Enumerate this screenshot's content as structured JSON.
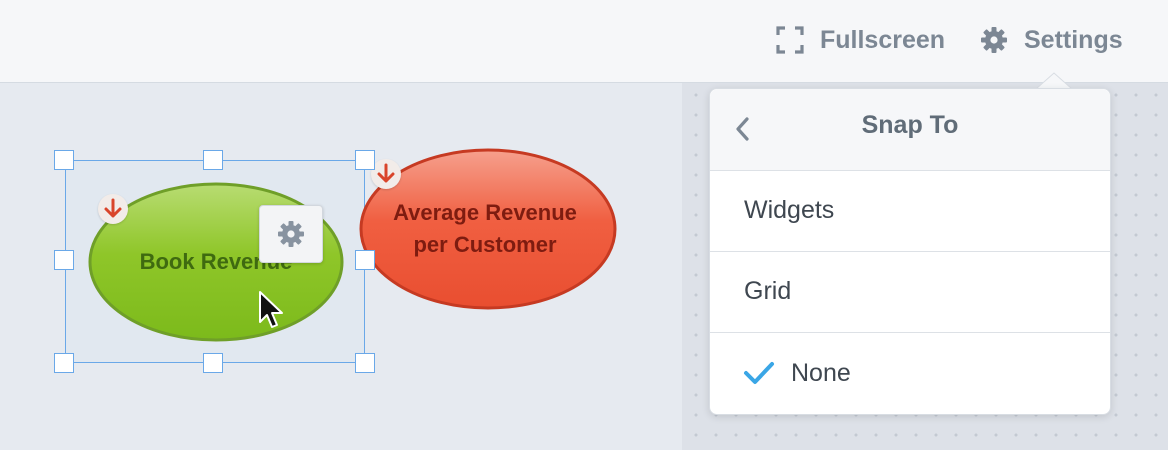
{
  "toolbar": {
    "fullscreen_label": "Fullscreen",
    "settings_label": "Settings",
    "fullscreen_icon": "fullscreen-icon",
    "settings_icon": "gear-icon"
  },
  "widgets": {
    "book_revenue": {
      "label": "Book Revenue",
      "color": "#86c11f",
      "arrow": "arrow-down-icon"
    },
    "avg_revenue": {
      "line1": "Average Revenue",
      "line2": "per Customer",
      "color": "#ef5a3c",
      "arrow": "arrow-down-icon"
    }
  },
  "snap_menu": {
    "title": "Snap To",
    "back_icon": "chevron-left-icon",
    "options": [
      {
        "label": "Widgets",
        "checked": false
      },
      {
        "label": "Grid",
        "checked": false
      },
      {
        "label": "None",
        "checked": true
      }
    ],
    "check_color": "#3aa6e6"
  },
  "colors": {
    "accent": "#6aa8e8",
    "arrow": "#d9452b"
  }
}
